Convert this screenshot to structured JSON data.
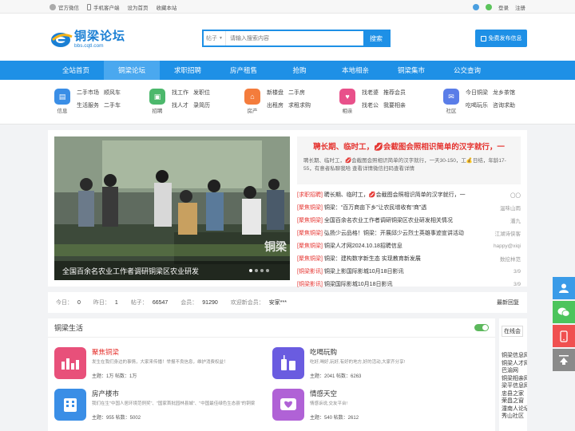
{
  "topbar": {
    "left": [
      "官方微信",
      "手机客户端",
      "设为首页",
      "收藏本站"
    ],
    "login": "登录",
    "register": "注册"
  },
  "logo": {
    "title": "铜梁论坛",
    "url": "bbs.cqtl.com"
  },
  "search": {
    "category": "帖子",
    "placeholder": "请输入搜索内容",
    "button": "搜索"
  },
  "post_button": "免费发布信息",
  "nav": [
    "全站首页",
    "铜梁论坛",
    "求职招聘",
    "房产租售",
    "抢购",
    "本地相亲",
    "铜梁集市",
    "公交查询"
  ],
  "categories": [
    {
      "label": "信息",
      "links": [
        "二手市场",
        "顺风车",
        "生活服务",
        "二手车"
      ],
      "color": "#3a8ee6"
    },
    {
      "label": "招聘",
      "links": [
        "找工作",
        "发职位",
        "找人才",
        "录简历"
      ],
      "color": "#4cb86c"
    },
    {
      "label": "房产",
      "links": [
        "新楼盘",
        "二手房",
        "出租房",
        "求租求购"
      ],
      "color": "#f47c3c"
    },
    {
      "label": "相亲",
      "links": [
        "找老婆",
        "推荐会员",
        "找老公",
        "我要相亲"
      ],
      "color": "#e8508a"
    },
    {
      "label": "社区",
      "links": [
        "今日铜梁",
        "龙乡茶馆",
        "吃喝玩乐",
        "咨询求助"
      ],
      "color": "#5a7de8"
    }
  ],
  "slider": {
    "caption": "全国百余名农业工作者调研铜梁区农业研发",
    "watermark": "铜梁"
  },
  "headline": {
    "title": "聘长期、临时工，💋会截图会照相识简单的汉字就行，一",
    "desc": "聘长期、临时工，💋会截图会照相识简单的汉字就行，一天30-150，工💰日结，年龄17-55，有意者私聊我哈 查看详情微信扫码查看详情"
  },
  "news": [
    {
      "tag": "[求职招聘]",
      "text": "聘长期、临时工，💋会截图会照相识简单的汉字就行，一",
      "src": "〇〇"
    },
    {
      "tag": "[聚焦铜梁]",
      "text": "铜梁：“百万商亩下乡”让农民增收有“商”透",
      "src": "温味山雨"
    },
    {
      "tag": "[聚焦铜梁]",
      "text": "全国百余名农业工作者调研铜梁区农业研发相关情况",
      "src": "潘九"
    },
    {
      "tag": "[聚焦铜梁]",
      "text": "弘扬少云品格！铜梁：开展邱少云烈士英雄事迹宣讲活动",
      "src": "江湖诗侠客"
    },
    {
      "tag": "[聚焦铜梁]",
      "text": "铜梁人才网2024.10.18招聘信息",
      "src": "happy@xiqi"
    },
    {
      "tag": "[聚焦铜梁]",
      "text": "铜梁：建构数字新生态 实现教育新发展",
      "src": "数挖林范"
    },
    {
      "tag": "[铜梁影讯]",
      "text": "铜梁上影国际影城10月18日影讯",
      "src": "3/9"
    },
    {
      "tag": "[铜梁影讯]",
      "text": "铜梁国际影城10月18日影讯",
      "src": "3/9"
    }
  ],
  "stats": {
    "today_label": "今日：",
    "today": "0",
    "yesterday_label": "昨日：",
    "yesterday": "1",
    "posts_label": "帖子：",
    "posts": "66547",
    "members_label": "会员：",
    "members": "91290",
    "welcome_label": "欢迎新会员：",
    "new_member": "安家***",
    "latest": "最新回复"
  },
  "life": {
    "title": "铜梁生活",
    "forums": [
      {
        "name": "聚焦铜梁",
        "desc": "发生在我们身边的事情，大家来传播！举报不良信息，维护消费权益！",
        "meta": "主题：1万   帖数：1万",
        "color": "#e8507a",
        "red": true
      },
      {
        "name": "吃喝玩购",
        "desc": "吃好,喝好,玩好,有好的地方,好的活动,大家齐分享!",
        "meta": "主题：2041   帖数：6263",
        "color": "#6a5ce0",
        "red": false
      },
      {
        "name": "房产楼市",
        "desc": "我们在生\"中国人居环境范例奖\"、\"国家首批园林县城\"、\"中国最佳绿色生态县\"的铜梁",
        "meta": "主题：955   帖数：5002",
        "color": "#3a8ee6",
        "red": false
      },
      {
        "name": "情感天空",
        "desc": "情感诉说,交友平台!",
        "meta": "主题：540   帖数：2612",
        "color": "#b062d6",
        "red": false
      }
    ]
  },
  "sidebar": {
    "tab": "在线会",
    "items": [
      "铜梁信息网",
      "铜梁人才网",
      "巴渝网",
      "铜梁相亲网",
      "梁平信息网",
      "忠县之家",
      "荣昌之窗",
      "潼南人论坛",
      "秀山社区"
    ]
  }
}
